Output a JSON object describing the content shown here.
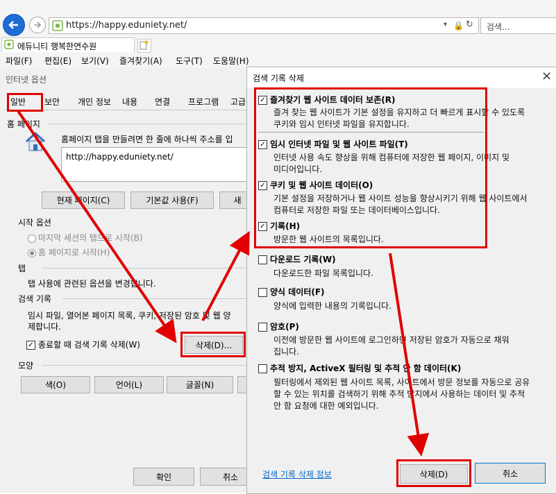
{
  "browser": {
    "url": "https://happy.eduniety.net/",
    "search_placeholder": "검색...",
    "tab_title": "에듀니티 행복한연수원",
    "menu": [
      "파일(F)",
      "편집(E)",
      "보기(V)",
      "즐겨찾기(A)",
      "도구(T)",
      "도움말(H)"
    ]
  },
  "inet_options": {
    "title": "인터넷 옵션",
    "tabs": [
      "일반",
      "보안",
      "개인 정보",
      "내용",
      "연결",
      "프로그램",
      "고급"
    ],
    "homepage": {
      "heading": "홈 페이지",
      "desc": "홈페이지 탭을 만들려면 한 줄에 하나씩 주소를 입",
      "value": "http://happy.eduniety.net/",
      "btn_current": "현재 페이지(C)",
      "btn_default": "기본값 사용(F)",
      "btn_new": "새"
    },
    "startup": {
      "heading": "시작 옵션",
      "opt_last": "마지막 세션의 탭으로 시작(B)",
      "opt_home": "홈 페이지로 시작(H)"
    },
    "tabs_section": {
      "heading": "탭",
      "desc": "탭 사용에 관련된 옵션을 변경합니다."
    },
    "history": {
      "heading": "검색 기록",
      "desc1": "임시 파일, 열어본 페이지 목록, 쿠키, 저장된 암호 및 웹 양",
      "desc2": "제합니다.",
      "checkbox": "종료할 때 검색 기록 삭제(W)",
      "delete_btn": "삭제(D)..."
    },
    "appearance": {
      "heading": "모양",
      "btn_color": "색(O)",
      "btn_lang": "언어(L)",
      "btn_font": "글꼴(N)"
    },
    "ok": "확인",
    "cancel": "취소"
  },
  "delete_history": {
    "title": "검색 기록 삭제",
    "close": "×",
    "options": [
      {
        "title": "즐겨찾기 웹 사이트 데이터 보존(R)",
        "checked": true,
        "desc": [
          "즐겨 찾는 웹 사이트가 기본 설정을 유지하고 더 빠르게 표시할 수 있도록",
          "쿠키와 임시 인터넷 파일을 유지합니다."
        ]
      },
      {
        "title": "임시 인터넷 파일 및 웹 사이트 파일(T)",
        "checked": true,
        "desc": [
          "인터넷 사용 속도 향상을 위해 컴퓨터에 저장한 웹 페이지, 이미지 및",
          "미디어입니다."
        ]
      },
      {
        "title": "쿠키 및 웹 사이트 데이터(O)",
        "checked": true,
        "desc": [
          "기본 설정을 저장하거나 웹 사이트 성능을 향상시키기 위해 웹 사이트에서",
          "컴퓨터로 저장한 파일 또는 데이터베이스입니다."
        ]
      },
      {
        "title": "기록(H)",
        "checked": true,
        "desc": [
          "방문한 웹 사이트의 목록입니다."
        ]
      },
      {
        "title": "다운로드 기록(W)",
        "checked": false,
        "desc": [
          "다운로드한 파일 목록입니다."
        ]
      },
      {
        "title": "양식 데이터(F)",
        "checked": false,
        "desc": [
          "양식에 입력한 내용의 기록입니다."
        ]
      },
      {
        "title": "암호(P)",
        "checked": false,
        "desc": [
          "이전에 방문한 웹 사이트에 로그인하면 저장된 암호가 자동으로 채워",
          "집니다."
        ]
      },
      {
        "title": "추적 방지, ActiveX 필터링 및 추적 안 함 데이터(K)",
        "checked": false,
        "desc": [
          "필터링에서 제외된 웹 사이트 목록, 사이트에서 방문 정보를 자동으로 공유",
          "할 수 있는 위치를 검색하기 위해 추적 방지에서 사용하는 데이터 및 추적",
          "안 함 요청에 대한 예외입니다."
        ]
      }
    ],
    "about_link": "검색 기록 삭제 정보",
    "delete_btn": "삭제(D)",
    "cancel_btn": "취소"
  },
  "colors": {
    "highlight": "#e00000",
    "accent": "#1e6bd4"
  }
}
